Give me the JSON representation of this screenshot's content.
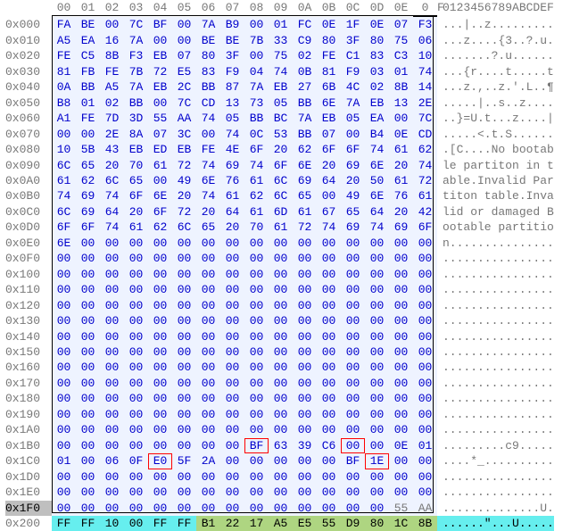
{
  "header": {
    "offset_blank": "",
    "hex_cols": [
      "00",
      "01",
      "02",
      "03",
      "04",
      "05",
      "06",
      "07",
      "08",
      "09",
      "0A",
      "0B",
      "0C",
      "0D",
      "0E",
      "0F"
    ],
    "hex_cursor_col": 15,
    "asc_label": "0123456789ABCDEF"
  },
  "rows": [
    {
      "off": "0x000",
      "sel": true,
      "bytes": "FA BE 00 7C BF 00 7A B9 00 01 FC 0E 1F 0E 07 F3",
      "asc": "...|..z........."
    },
    {
      "off": "0x010",
      "sel": true,
      "bytes": "A5 EA 16 7A 00 00 BE BE 7B 33 C9 80 3F 80 75 06",
      "asc": "...z....{3..?.u."
    },
    {
      "off": "0x020",
      "sel": true,
      "bytes": "FE C5 8B F3 EB 07 80 3F 00 75 02 FE C1 83 C3 10",
      "asc": ".......?.u......"
    },
    {
      "off": "0x030",
      "sel": true,
      "bytes": "81 FB FE 7B 72 E5 83 F9 04 74 0B 81 F9 03 01 74",
      "asc": "...{r....t.....t"
    },
    {
      "off": "0x040",
      "sel": true,
      "bytes": "0A BB A5 7A EB 2C BB 87 7A EB 27 6B 4C 02 8B 14",
      "asc": "...z.,..z.'.L..¶"
    },
    {
      "off": "0x050",
      "sel": true,
      "bytes": "B8 01 02 BB 00 7C CD 13 73 05 BB 6E 7A EB 13 2E",
      "asc": ".....|..s..z...."
    },
    {
      "off": "0x060",
      "sel": true,
      "bytes": "A1 FE 7D 3D 55 AA 74 05 BB BC 7A EB 05 EA 00 7C",
      "asc": "..}=U.t...z....|"
    },
    {
      "off": "0x070",
      "sel": true,
      "bytes": "00 00 2E 8A 07 3C 00 74 0C 53 BB 07 00 B4 0E CD",
      "asc": ".....<.t.S......"
    },
    {
      "off": "0x080",
      "sel": true,
      "bytes": "10 5B 43 EB ED EB FE 4E 6F 20 62 6F 6F 74 61 62",
      "asc": ".[C....No bootab"
    },
    {
      "off": "0x090",
      "sel": true,
      "bytes": "6C 65 20 70 61 72 74 69 74 6F 6E 20 69 6E 20 74",
      "asc": "le partiton in t"
    },
    {
      "off": "0x0A0",
      "sel": true,
      "bytes": "61 62 6C 65 00 49 6E 76 61 6C 69 64 20 50 61 72",
      "asc": "able.Invalid Par"
    },
    {
      "off": "0x0B0",
      "sel": true,
      "bytes": "74 69 74 6F 6E 20 74 61 62 6C 65 00 49 6E 76 61",
      "asc": "titon table.Inva"
    },
    {
      "off": "0x0C0",
      "sel": true,
      "bytes": "6C 69 64 20 6F 72 20 64 61 6D 61 67 65 64 20 42",
      "asc": "lid or damaged B"
    },
    {
      "off": "0x0D0",
      "sel": true,
      "bytes": "6F 6F 74 61 62 6C 65 20 70 61 72 74 69 74 69 6F",
      "asc": "ootable partitio"
    },
    {
      "off": "0x0E0",
      "sel": true,
      "bytes": "6E 00 00 00 00 00 00 00 00 00 00 00 00 00 00 00",
      "asc": "n..............."
    },
    {
      "off": "0x0F0",
      "sel": true,
      "bytes": "00 00 00 00 00 00 00 00 00 00 00 00 00 00 00 00",
      "asc": "................"
    },
    {
      "off": "0x100",
      "sel": true,
      "bytes": "00 00 00 00 00 00 00 00 00 00 00 00 00 00 00 00",
      "asc": "................"
    },
    {
      "off": "0x110",
      "sel": true,
      "bytes": "00 00 00 00 00 00 00 00 00 00 00 00 00 00 00 00",
      "asc": "................"
    },
    {
      "off": "0x120",
      "sel": true,
      "bytes": "00 00 00 00 00 00 00 00 00 00 00 00 00 00 00 00",
      "asc": "................"
    },
    {
      "off": "0x130",
      "sel": true,
      "bytes": "00 00 00 00 00 00 00 00 00 00 00 00 00 00 00 00",
      "asc": "................"
    },
    {
      "off": "0x140",
      "sel": true,
      "bytes": "00 00 00 00 00 00 00 00 00 00 00 00 00 00 00 00",
      "asc": "................"
    },
    {
      "off": "0x150",
      "sel": true,
      "bytes": "00 00 00 00 00 00 00 00 00 00 00 00 00 00 00 00",
      "asc": "................"
    },
    {
      "off": "0x160",
      "sel": true,
      "bytes": "00 00 00 00 00 00 00 00 00 00 00 00 00 00 00 00",
      "asc": "................"
    },
    {
      "off": "0x170",
      "sel": true,
      "bytes": "00 00 00 00 00 00 00 00 00 00 00 00 00 00 00 00",
      "asc": "................"
    },
    {
      "off": "0x180",
      "sel": true,
      "bytes": "00 00 00 00 00 00 00 00 00 00 00 00 00 00 00 00",
      "asc": "................"
    },
    {
      "off": "0x190",
      "sel": true,
      "bytes": "00 00 00 00 00 00 00 00 00 00 00 00 00 00 00 00",
      "asc": "................"
    },
    {
      "off": "0x1A0",
      "sel": true,
      "bytes": "00 00 00 00 00 00 00 00 00 00 00 00 00 00 00 00",
      "asc": "................"
    },
    {
      "off": "0x1B0",
      "sel": true,
      "bytes": "00 00 00 00 00 00 00 00 BF 63 39 C6 00 00 0E 01",
      "asc": ".........c9.....",
      "red": [
        8,
        12
      ]
    },
    {
      "off": "0x1C0",
      "sel": true,
      "bytes": "01 00 06 0F E0 5F 2A 00 00 00 00 00 BF 1E 00 00",
      "asc": "....*_..........",
      "red": [
        4,
        13
      ]
    },
    {
      "off": "0x1D0",
      "sel": true,
      "bytes": "00 00 00 00 00 00 00 00 00 00 00 00 00 00 00 00",
      "asc": "................"
    },
    {
      "off": "0x1E0",
      "sel": true,
      "bytes": "00 00 00 00 00 00 00 00 00 00 00 00 00 00 00 00",
      "asc": "................"
    },
    {
      "off": "0x1F0",
      "sel": true,
      "bytes": "00 00 00 00 00 00 00 00 00 00 00 00 00 00 55 AA",
      "asc": "..............U.",
      "off_hi": true,
      "tail_grey": [
        14,
        15
      ]
    },
    {
      "off": "0x200",
      "sel": false,
      "bytes": "FF FF 10 00 FF FF B1 22 17 A5 E5 55 D9 80 1C 8B",
      "asc": "......\"...U.....",
      "split": 6
    }
  ]
}
